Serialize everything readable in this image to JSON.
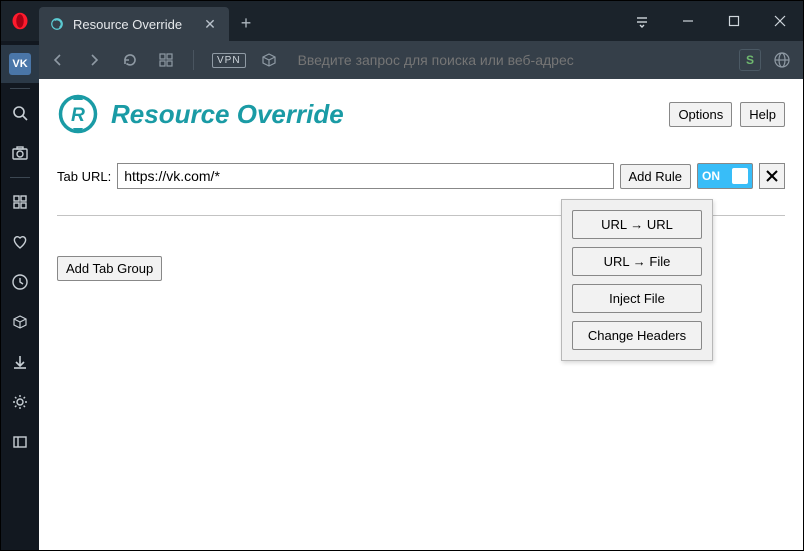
{
  "window": {
    "tab_title": "Resource Override"
  },
  "address_bar": {
    "vpn_label": "VPN",
    "placeholder": "Введите запрос для поиска или веб-адрес",
    "badge_letter": "S"
  },
  "sidebar": {
    "vk_label": "VK"
  },
  "page": {
    "title": "Resource Override",
    "options_label": "Options",
    "help_label": "Help"
  },
  "tab_group": {
    "url_label": "Tab URL:",
    "url_value": "https://vk.com/*",
    "add_rule_label": "Add Rule",
    "toggle_text": "ON"
  },
  "dropdown": {
    "url_url": "URL → URL",
    "url_file": "URL → File",
    "inject_file": "Inject File",
    "change_headers": "Change Headers"
  },
  "add_tab_group_label": "Add Tab Group"
}
